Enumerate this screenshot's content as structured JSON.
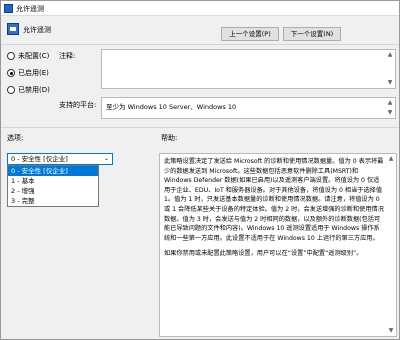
{
  "window": {
    "title": "允许遥测"
  },
  "header": {
    "title": "允许遥测"
  },
  "nav": {
    "prev_label": "上一个设置(P)",
    "next_label": "下一个设置(N)"
  },
  "state": {
    "options": [
      {
        "label": "未配置(C)",
        "checked": false
      },
      {
        "label": "已启用(E)",
        "checked": true
      },
      {
        "label": "已禁用(D)",
        "checked": false
      }
    ]
  },
  "comment": {
    "label": "注释:",
    "value": ""
  },
  "platform": {
    "label": "支持的平台:",
    "value": "至少为 Windows 10 Server、Windows 10"
  },
  "options_section": {
    "label": "选项:",
    "selected": "0 - 安全性 [仅企业]",
    "items": [
      "0 - 安全性 [仅企业]",
      "1 - 基本",
      "2 - 增强",
      "3 - 完整"
    ]
  },
  "help": {
    "label": "帮助:",
    "paragraphs": [
      "此策略设置决定了发送给 Microsoft 的诊断和使用情况数据量。值为 0 表示将最少的数据发送到 Microsoft。这些数据包括恶意软件删除工具(MSRT)和 Windows Defender 数据(如果已启用)以及遥测客户端设置。将值设为 0 仅适用于企业、EDU、IoT 和服务器设备。对于其他设备，将值设为 0 相当于选择值 1。值为 1 时，只发送基本数据量的诊断和使用情况数据。请注意，将值设为 0 或 1 会降低某些关于设备的特定体验。值为 2 时，会发送增强的诊断和使用情况数据。值为 3 时，会发送与值为 2 时相同的数据，以及额外的诊断数据(包括可能已导致问题的文件和内容)。Windows 10 遥测设置适用于 Windows 操作系统和一些第一方应用。此设置不适用于在 Windows 10 上运行的第三方应用。",
      "如果你禁用或未配置此策略设置，用户可以在“设置”中配置“遥测级别”。"
    ]
  }
}
